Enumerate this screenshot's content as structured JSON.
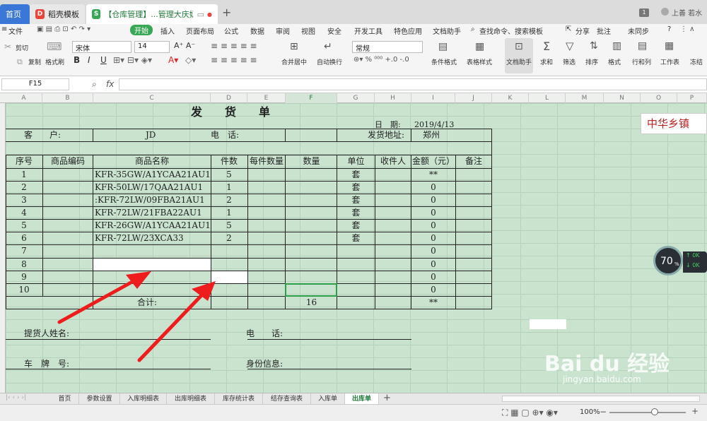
{
  "tabs": [
    {
      "label": "首页"
    },
    {
      "label": "稻壳模板"
    },
    {
      "label": "【仓库管理】...管理大庆奶粉"
    }
  ],
  "user": {
    "badge": "1",
    "name": "上善 若水"
  },
  "menu": {
    "file": "文件",
    "start": "开始",
    "items": [
      "插入",
      "页面布局",
      "公式",
      "数据",
      "审阅",
      "视图",
      "安全",
      "开发工具",
      "特色应用",
      "文档助手"
    ],
    "search": "查找命令、搜索模板",
    "share": "分享",
    "comment": "批注",
    "sync": "未同步",
    "help": "?"
  },
  "ribbon": {
    "cut": "剪切",
    "copy": "复制",
    "format_painter": "格式刷",
    "font": "宋体",
    "size": "14",
    "merge": "合并居中",
    "wrap": "自动换行",
    "numfmt": "常规",
    "cond_fmt": "条件格式",
    "table_style": "表格样式",
    "doc_helper": "文档助手",
    "sum": "求和",
    "filter": "筛选",
    "sort": "排序",
    "format": "格式",
    "rowcol": "行和列",
    "sheet": "工作表",
    "more": "冻结"
  },
  "formula": {
    "cellref": "F15",
    "fx": "fx"
  },
  "columns": [
    "A",
    "B",
    "C",
    "D",
    "E",
    "F",
    "G",
    "H",
    "I",
    "J",
    "K",
    "L",
    "M",
    "N",
    "O",
    "P"
  ],
  "sheet": {
    "title": "发　　货　　单",
    "date_label": "日　期:",
    "date_value": "2019/4/13",
    "customer_label": "客　　户:",
    "customer_value": "JD",
    "phone_label": "电　话:",
    "addr_label": "发货地址:",
    "addr_value": "郑州",
    "headers": [
      "序号",
      "商品编码",
      "商品名称",
      "件数",
      "每件数量",
      "数量",
      "单位",
      "收件人",
      "金额（元）",
      "备注"
    ],
    "rows": [
      {
        "no": "1",
        "name": "KFR-35GW/A1YCAA21AU1",
        "pieces": "5",
        "unit": "套",
        "amount": "**"
      },
      {
        "no": "2",
        "name": "KFR-50LW/17QAA21AU1",
        "pieces": "1",
        "unit": "套",
        "amount": "0"
      },
      {
        "no": "3",
        "name": ":KFR-72LW/09FBA21AU1",
        "pieces": "2",
        "unit": "套",
        "amount": "0"
      },
      {
        "no": "4",
        "name": "KFR-72LW/21FBA22AU1",
        "pieces": "1",
        "unit": "套",
        "amount": "0"
      },
      {
        "no": "5",
        "name": "KFR-26GW/A1YCAA21AU1",
        "pieces": "5",
        "unit": "套",
        "amount": "0"
      },
      {
        "no": "6",
        "name": "KFR-72LW/23XCA33",
        "pieces": "2",
        "unit": "套",
        "amount": "0"
      },
      {
        "no": "7",
        "name": "",
        "pieces": "",
        "unit": "",
        "amount": "0"
      },
      {
        "no": "8",
        "name": "",
        "pieces": "",
        "unit": "",
        "amount": "0"
      },
      {
        "no": "9",
        "name": "",
        "pieces": "",
        "unit": "",
        "amount": "0"
      },
      {
        "no": "10",
        "name": "",
        "pieces": "",
        "unit": "",
        "amount": "0"
      }
    ],
    "total_label": "合计:",
    "total_qty": "16",
    "total_amount": "**",
    "picker_label": "提货人姓名:",
    "phone2_label": "电　　话:",
    "plate_label": "车　牌　号:",
    "id_label": "身份信息:"
  },
  "logo_text": "中华乡镇",
  "zoom_widget": {
    "value": "70",
    "unit": "%"
  },
  "sheet_tabs": [
    "首页",
    "参数设置",
    "入库明细表",
    "出库明细表",
    "库存统计表",
    "结存查询表",
    "入库单",
    "出库单"
  ],
  "active_sheet": "出库单",
  "status": {
    "zoom": "100%"
  },
  "watermark": {
    "brand": "Bai du 经验",
    "url": "jingyan.baidu.com"
  }
}
